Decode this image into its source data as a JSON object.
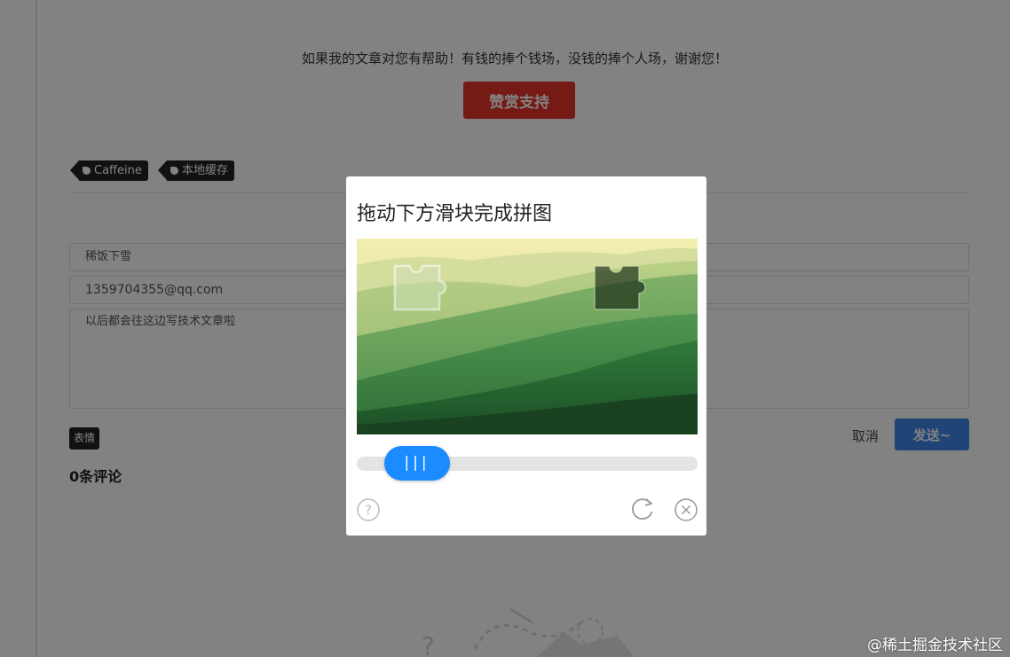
{
  "article": {
    "donate_text": "如果我的文章对您有帮助！有钱的捧个钱场，没钱的捧个人场，谢谢您！",
    "donate_button": "赞赏支持",
    "tags": [
      "Caffeine",
      "本地缓存"
    ]
  },
  "comment_form": {
    "name_value": "稀饭下雪",
    "email_value": "1359704355@qq.com",
    "content_value": "以后都会往这边写技术文章啦",
    "emoji_button": "表情",
    "cancel_label": "取消",
    "send_label": "发送~",
    "comment_count": "0条评论"
  },
  "captcha": {
    "title": "拖动下方滑块完成拼图",
    "handle_glyph": "|||",
    "slider_progress": 0.0
  },
  "watermark": "@稀土掘金技术社区",
  "colors": {
    "donate_button": "#e8332c",
    "send_button": "#3d86e6",
    "slider_handle": "#1a8cff",
    "tag_background": "#222222"
  },
  "icons": [
    "tag-icon",
    "help-icon",
    "refresh-icon",
    "close-icon"
  ]
}
